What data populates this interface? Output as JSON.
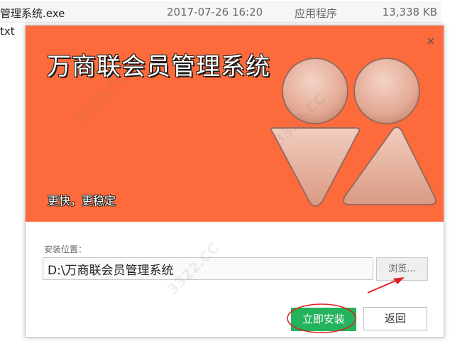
{
  "background": {
    "file_row": {
      "name": "管理系统.exe",
      "date": "2017-07-26 16:20",
      "type": "应用程序",
      "size": "13,338 KB"
    },
    "next_row": {
      "name": "txt"
    }
  },
  "dialog": {
    "title": "万商联会员管理系统",
    "tagline": "更快，更稳定",
    "close_icon": "×",
    "install_path": {
      "label": "安装位置：",
      "value": "D:\\万商联会员管理系统"
    },
    "browse_button": "浏览...",
    "install_button": "立即安装",
    "back_button": "返回"
  },
  "watermark": "3322.CC",
  "colors": {
    "banner": "#fd6b3c",
    "install_button": "#22b35c",
    "annotation": "#e02020"
  }
}
